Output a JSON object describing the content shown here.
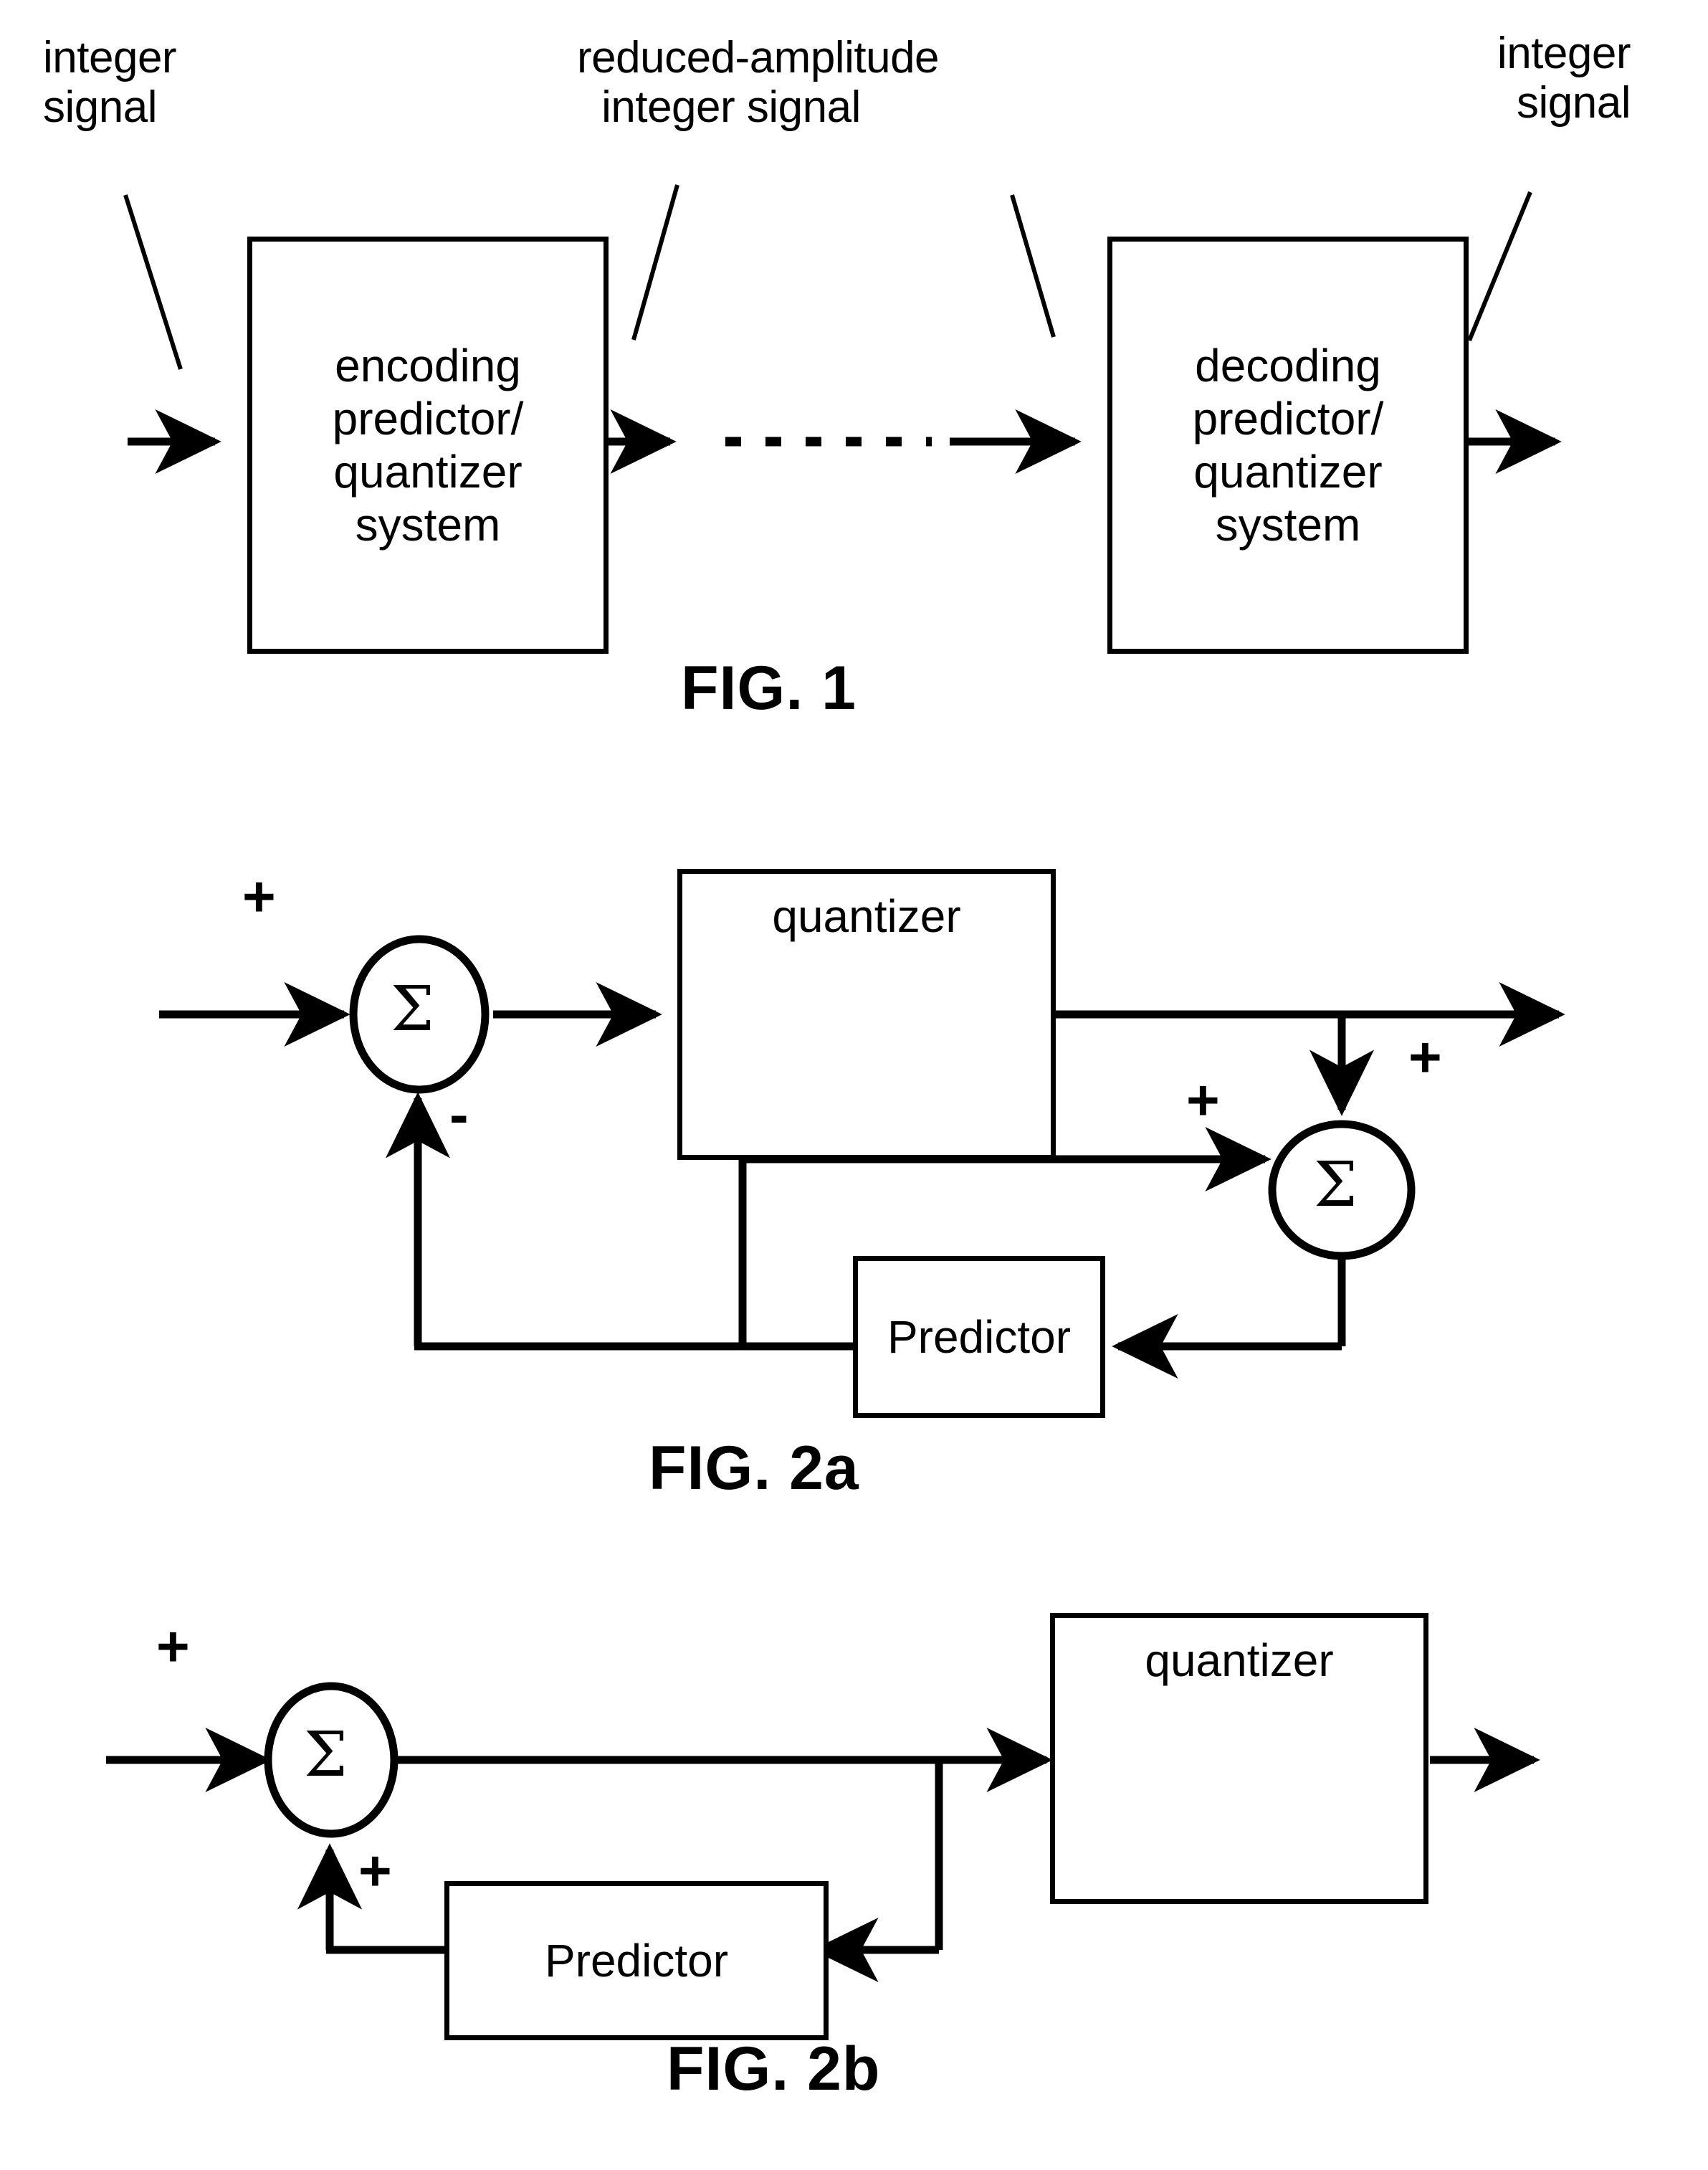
{
  "figure_set": {
    "title_hidden": "Patent block diagrams: predictive quantizer systems"
  },
  "fig1": {
    "label": "FIG. 1",
    "annotations": {
      "input_label": "integer\nsignal",
      "middle_label": "reduced-amplitude\ninteger signal",
      "output_label": "integer\nsignal"
    },
    "blocks": [
      {
        "id": "encoder",
        "lines": [
          "encoding",
          "predictor/",
          "quantizer",
          "system"
        ]
      },
      {
        "id": "decoder",
        "lines": [
          "decoding",
          "predictor/",
          "quantizer",
          "system"
        ]
      }
    ],
    "link_style": "dashed-channel"
  },
  "fig2a": {
    "label": "FIG. 2a",
    "blocks": [
      {
        "id": "quantizer",
        "label": "quantizer",
        "glyph": "staircase-5-step"
      },
      {
        "id": "predictor",
        "label": "Predictor"
      }
    ],
    "adders": [
      {
        "id": "adder-1",
        "symbol": "Σ",
        "input_signs": [
          "+",
          "-"
        ]
      },
      {
        "id": "adder-2",
        "symbol": "Σ",
        "input_signs": [
          "+",
          "+"
        ]
      }
    ],
    "signs": {
      "input_plus": "+",
      "feedback_minus": "-",
      "predictor_plus": "+",
      "quantized_plus": "+"
    }
  },
  "fig2b": {
    "label": "FIG. 2b",
    "blocks": [
      {
        "id": "quantizer",
        "label": "quantizer",
        "glyph": "staircase-5-step"
      },
      {
        "id": "predictor",
        "label": "Predictor"
      }
    ],
    "adders": [
      {
        "id": "adder-1",
        "symbol": "Σ",
        "input_signs": [
          "+",
          "+"
        ]
      }
    ],
    "signs": {
      "input_plus": "+",
      "feedback_plus": "+"
    }
  },
  "colors": {
    "ink": "#000000",
    "paper": "#ffffff"
  }
}
